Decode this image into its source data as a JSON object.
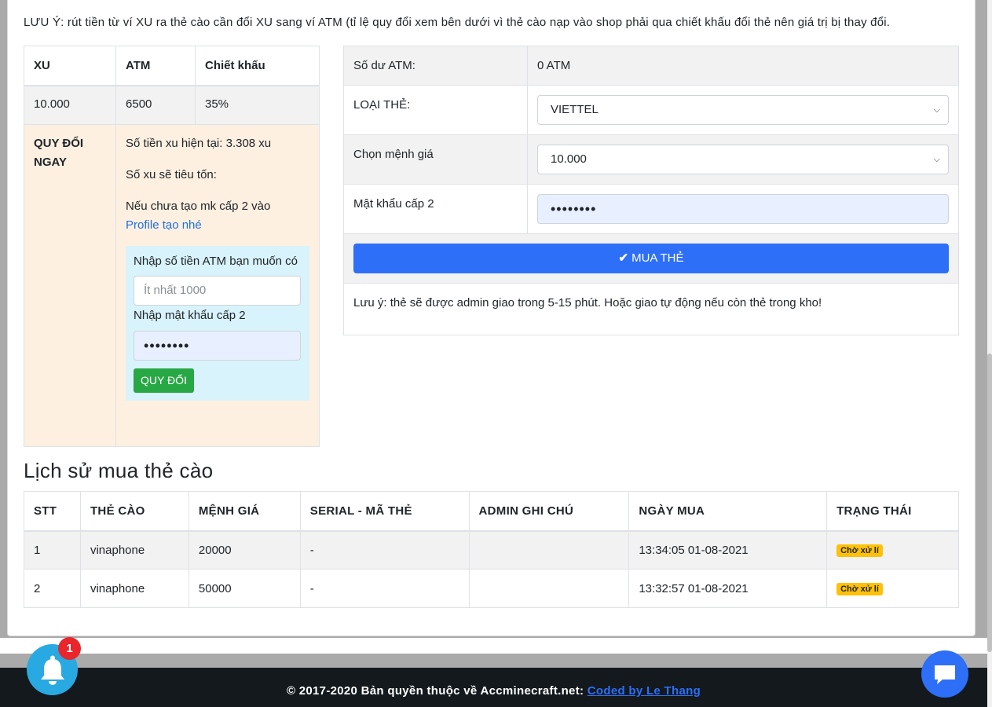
{
  "note_top": "LƯU Ý: rút tiền từ ví XU ra thẻ cào cần đổi XU sang ví ATM (tỉ lệ quy đổi xem bên dưới vì thẻ cào nạp vào shop phải qua chiết khấu đổi thẻ nên giá trị bị thay đổi.",
  "exchange": {
    "headers": [
      "XU",
      "ATM",
      "Chiết khấu"
    ],
    "row": [
      "10.000",
      "6500",
      "35%"
    ],
    "convert_label": "QUY ĐỔI NGAY",
    "current_xu": "Số tiền xu hiện tại: 3.308 xu",
    "xu_spent": "Số xu sẽ tiêu tốn:",
    "no_pw_note": "Nếu chưa tạo mk cấp 2 vào",
    "profile_link": "Profile tạo nhé",
    "atm_label": "Nhập số tiền ATM bạn muốn có",
    "atm_placeholder": "Ít nhất 1000",
    "pw_label": "Nhập mật khẩu cấp 2",
    "pw_value": "••••••••",
    "convert_button": "QUY ĐỔI"
  },
  "buy": {
    "balance_label": "Số dư ATM:",
    "balance_value": "0 ATM",
    "card_type_label": "LOẠI THẺ:",
    "card_type_value": "VIETTEL",
    "denom_label": "Chọn mệnh giá",
    "denom_value": "10.000",
    "pw_label": "Mật khẩu cấp 2",
    "pw_value": "••••••••",
    "buy_button": "MUA THẺ",
    "note": "Lưu ý: thẻ sẽ được admin giao trong 5-15 phút. Hoặc giao tự động nếu còn thẻ trong kho!"
  },
  "history": {
    "title": "Lịch sử mua thẻ cào",
    "headers": [
      "STT",
      "THẺ CÀO",
      "MỆNH GIÁ",
      "SERIAL - MÃ THẺ",
      "ADMIN GHI CHÚ",
      "NGÀY MUA",
      "TRẠNG THÁI"
    ],
    "rows": [
      {
        "stt": "1",
        "card": "vinaphone",
        "value": "20000",
        "serial": "-",
        "note": "",
        "date": "13:34:05 01-08-2021",
        "status": "Chờ xử lí"
      },
      {
        "stt": "2",
        "card": "vinaphone",
        "value": "50000",
        "serial": "-",
        "note": "",
        "date": "13:32:57 01-08-2021",
        "status": "Chờ xử lí"
      }
    ]
  },
  "footer": {
    "copyright": "© 2017-2020 Bản quyền thuộc về Accminecraft.net:",
    "coded_by": "Coded by Le Thang"
  },
  "notification_count": "1",
  "colors": {
    "primary": "#2d6ff7",
    "success": "#28a745",
    "warning": "#ffc107",
    "bell": "#29a9e1",
    "footer": "#13191d"
  }
}
